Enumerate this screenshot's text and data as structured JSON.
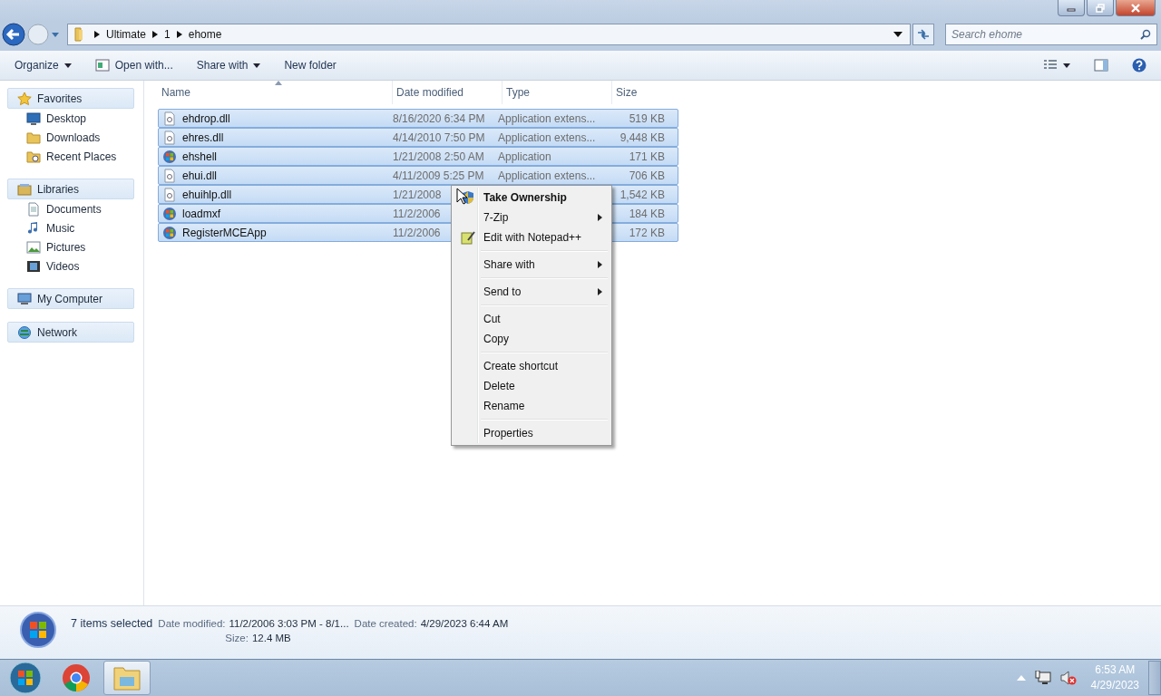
{
  "address_bar": {
    "crumbs": [
      "Ultimate",
      "1",
      "ehome"
    ]
  },
  "search": {
    "placeholder": "Search ehome"
  },
  "toolbar": {
    "buttons": [
      {
        "label": "Organize",
        "kind": "dropdown"
      },
      {
        "label": "Open with...",
        "kind": "icon"
      },
      {
        "label": "Share with",
        "kind": "dropdown"
      },
      {
        "label": "New folder",
        "kind": "plain"
      }
    ]
  },
  "sidebar": {
    "groups": [
      {
        "label": "Favorites",
        "children": [
          {
            "label": "Desktop"
          },
          {
            "label": "Downloads"
          },
          {
            "label": "Recent Places"
          }
        ]
      },
      {
        "label": "Libraries",
        "children": [
          {
            "label": "Documents"
          },
          {
            "label": "Music"
          },
          {
            "label": "Pictures"
          },
          {
            "label": "Videos"
          }
        ]
      },
      {
        "label": "My Computer"
      },
      {
        "label": "Network"
      }
    ]
  },
  "table": {
    "columns": [
      {
        "label": "Name",
        "sorted": true
      },
      {
        "label": "Date modified",
        "sorted": false
      },
      {
        "label": "Type",
        "sorted": false
      },
      {
        "label": "Size",
        "sorted": false
      }
    ],
    "rows": [
      {
        "kind": "dll",
        "name": "ehdrop.dll",
        "date": "8/16/2020 6:34 PM",
        "type": "Application extens...",
        "size": "519 KB",
        "selected": true
      },
      {
        "kind": "dll",
        "name": "ehres.dll",
        "date": "4/14/2010 7:50 PM",
        "type": "Application extens...",
        "size": "9,448 KB",
        "selected": true
      },
      {
        "kind": "app",
        "name": "ehshell",
        "date": "1/21/2008 2:50 AM",
        "type": "Application",
        "size": "171 KB",
        "selected": true
      },
      {
        "kind": "dll",
        "name": "ehui.dll",
        "date": "4/11/2009 5:25 PM",
        "type": "Application extens...",
        "size": "706 KB",
        "selected": true
      },
      {
        "kind": "dll",
        "name": "ehuihlp.dll",
        "date": "1/21/2008",
        "size": "1,542 KB",
        "selected": true
      },
      {
        "kind": "app",
        "name": "loadmxf",
        "date": "11/2/2006",
        "size": "184 KB",
        "selected": true
      },
      {
        "kind": "app",
        "name": "RegisterMCEApp",
        "date": "11/2/2006",
        "size": "172 KB",
        "selected": true
      }
    ]
  },
  "context_menu": {
    "groups": [
      [
        {
          "label": "Take Ownership",
          "default": true,
          "submenu": false
        },
        {
          "label": "7-Zip",
          "default": false,
          "submenu": true
        },
        {
          "label": "Edit with Notepad++",
          "default": false,
          "submenu": false
        }
      ],
      [
        {
          "label": "Share with",
          "default": false,
          "submenu": true
        }
      ],
      [
        {
          "label": "Send to",
          "default": false,
          "submenu": true
        }
      ],
      [
        {
          "label": "Cut",
          "default": false,
          "submenu": false
        },
        {
          "label": "Copy",
          "default": false,
          "submenu": false
        }
      ],
      [
        {
          "label": "Create shortcut",
          "default": false,
          "submenu": false
        },
        {
          "label": "Delete",
          "default": false,
          "submenu": false
        },
        {
          "label": "Rename",
          "default": false,
          "submenu": false
        }
      ],
      [
        {
          "label": "Properties",
          "default": false,
          "submenu": false
        }
      ]
    ]
  },
  "details_pane": {
    "summary": "7 items selected",
    "fields": [
      {
        "label": "Date modified:",
        "value": "11/2/2006 3:03 PM - 8/1..."
      },
      {
        "label": "Date created:",
        "value": "4/29/2023 6:44 AM"
      },
      {
        "label": "Size:",
        "value": "12.4 MB"
      }
    ]
  },
  "taskbar": {
    "time": "6:53 AM",
    "date": "4/29/2023"
  }
}
